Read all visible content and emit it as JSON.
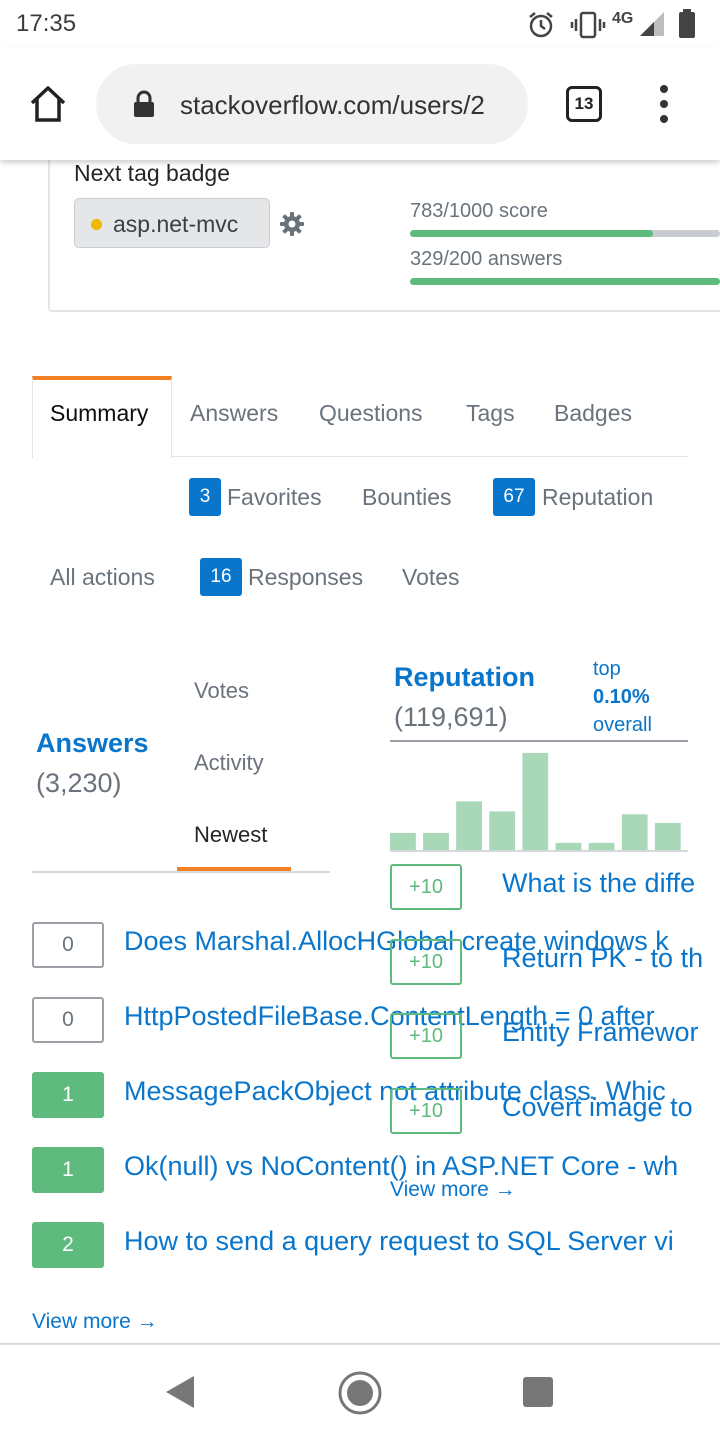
{
  "status_bar": {
    "time": "17:35",
    "network": "4G",
    "icons": [
      "alarm-icon",
      "vibrate-icon",
      "signal-icon",
      "battery-icon"
    ]
  },
  "browser": {
    "url": "stackoverflow.com/users/2",
    "tab_count": "13",
    "icons": [
      "home-icon",
      "lock-icon",
      "menu-dots-icon"
    ]
  },
  "badge": {
    "heading": "Next tag badge",
    "tag": "asp.net-mvc",
    "progress": [
      {
        "label": "783/1000 score",
        "fraction": 0.783
      },
      {
        "label": "329/200 answers",
        "fraction": 1.0
      }
    ]
  },
  "tabs": [
    "Summary",
    "Answers",
    "Questions",
    "Tags",
    "Badges"
  ],
  "selected_tab": "Summary",
  "subtabs_row1": [
    {
      "count": "3",
      "label": "Favorites"
    },
    {
      "count": "",
      "label": "Bounties"
    },
    {
      "count": "67",
      "label": "Reputation"
    }
  ],
  "subtabs_row2": [
    {
      "count": "",
      "label": "All actions"
    },
    {
      "count": "16",
      "label": "Responses"
    },
    {
      "count": "",
      "label": "Votes"
    }
  ],
  "answers_section": {
    "title": "Answers",
    "count": "(3,230)",
    "sort_options": [
      "Votes",
      "Activity",
      "Newest"
    ],
    "active_sort": "Newest",
    "items": [
      {
        "score": "0",
        "accepted": false,
        "title": "Does Marshal.AllocHGlobal create windows k"
      },
      {
        "score": "0",
        "accepted": false,
        "title": "HttpPostedFileBase.ContentLength = 0 after"
      },
      {
        "score": "1",
        "accepted": true,
        "title": "MessagePackObject not attribute class. Whic"
      },
      {
        "score": "1",
        "accepted": true,
        "title": "Ok(null) vs NoContent() in ASP.NET Core - wh"
      },
      {
        "score": "2",
        "accepted": true,
        "title": "How to send a query request to SQL Server vi"
      }
    ],
    "view_more": "View more →"
  },
  "reputation_section": {
    "title": "Reputation",
    "count": "(119,691)",
    "rank_prefix": "top",
    "rank_value": "0.10%",
    "rank_suffix": "overall",
    "items": [
      {
        "change": "+10",
        "title": "What is the diffe"
      },
      {
        "change": "+10",
        "title": "Return PK - to th"
      },
      {
        "change": "+10",
        "title": "Entity Framewor"
      },
      {
        "change": "+10",
        "title": "Covert image to"
      }
    ],
    "view_more": "View more →"
  },
  "chart_data": {
    "type": "bar",
    "values": [
      12,
      12,
      34,
      27,
      68,
      5,
      5,
      25,
      19
    ],
    "ylim": [
      0,
      70
    ],
    "grid": false,
    "color": "#a8d8b8"
  },
  "colors": {
    "link": "#0a76cb",
    "accent": "#f48024",
    "accepted": "#5eba7d",
    "count_pill": "#0a76cb"
  },
  "navigation": {
    "icons": [
      "back-icon",
      "home-circle-icon",
      "recents-icon"
    ]
  }
}
